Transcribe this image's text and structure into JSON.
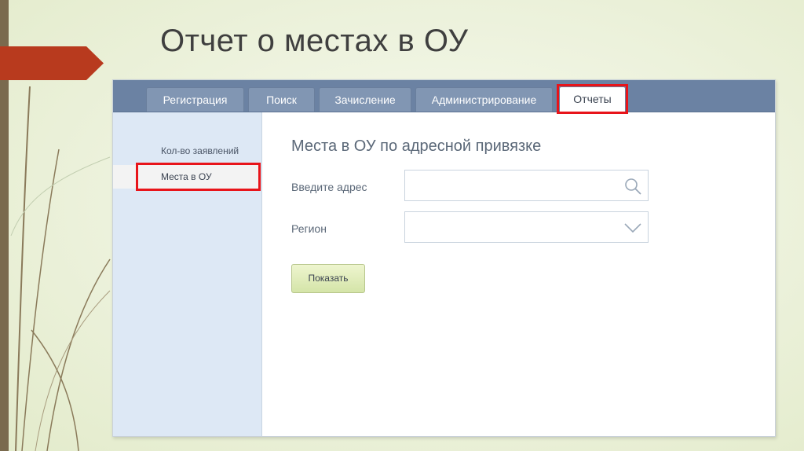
{
  "slide": {
    "title": "Отчет о местах в ОУ"
  },
  "tabs": [
    {
      "label": "Регистрация",
      "active": false
    },
    {
      "label": "Поиск",
      "active": false
    },
    {
      "label": "Зачисление",
      "active": false
    },
    {
      "label": "Администрирование",
      "active": false
    },
    {
      "label": "Отчеты",
      "active": true
    }
  ],
  "sidebar": {
    "items": [
      {
        "label": "Кол-во заявлений",
        "active": false
      },
      {
        "label": "Места в ОУ",
        "active": true
      }
    ]
  },
  "form": {
    "title": "Места в ОУ по адресной привязке",
    "address_label": "Введите адрес",
    "address_value": "",
    "region_label": "Регион",
    "region_value": "",
    "submit_label": "Показать"
  },
  "colors": {
    "highlight": "#e8141a",
    "tab_bar": "#6b82a3",
    "sidebar_bg": "#dde8f5",
    "button_bg": "#e2edc0",
    "slide_accent": "#b83a1e"
  },
  "icons": {
    "address_icon": "search-icon",
    "region_icon": "chevron-down-icon"
  }
}
